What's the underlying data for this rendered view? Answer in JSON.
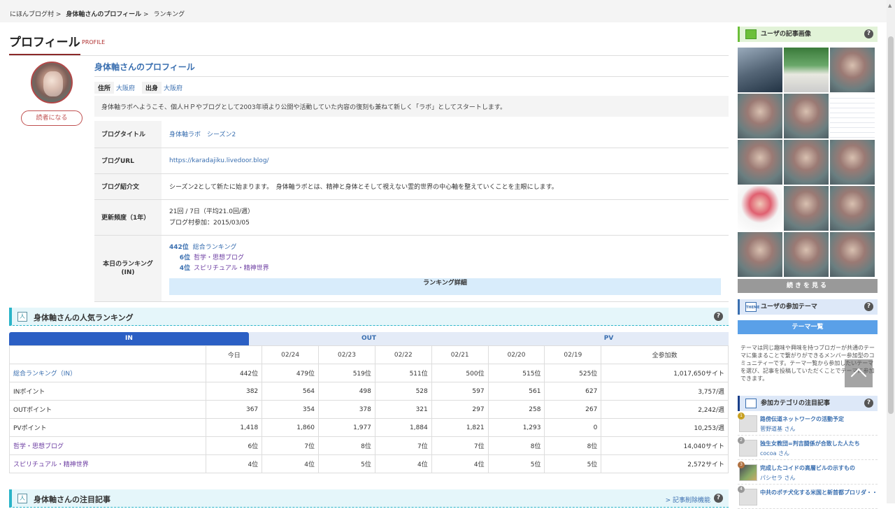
{
  "breadcrumb": [
    "にほんブログ村",
    ">",
    "身体軸さんのプロフィール",
    ">",
    "ランキング"
  ],
  "page_title": "プロフィール",
  "page_title_sub": "PROFILE",
  "profile": {
    "name": "身体軸さんのプロフィール",
    "reader_button": "読者になる",
    "location_label": "住所",
    "location_value": "大阪府",
    "origin_label": "出身",
    "origin_value": "大阪府",
    "intro": "身体軸ラボへようこそ、個人ＨＰやブログとして2003年頃より公開や活動していた内容の復刻も兼ねて新しく「ラボ」としてスタートします。"
  },
  "profile_table": {
    "blog_title_label": "ブログタイトル",
    "blog_title_value": "身体軸ラボ　シーズン2",
    "blog_url_label": "ブログURL",
    "blog_url_value": "https://karadajiku.livedoor.blog/",
    "blog_intro_label": "ブログ紹介文",
    "blog_intro_value": "シーズン2として新たに始まります。　身体軸ラボとは、精神と身体とそして視えない霊的世界の中心軸を整えていくことを主眼にします。",
    "update_label": "更新頻度（1年）",
    "update_value_1": "21回 / 7日（平均21.0回/週）",
    "update_value_2": "ブログ村参加：2015/03/05",
    "ranking_label_1": "本日のランキング",
    "ranking_label_2": "(IN)",
    "rankings": [
      {
        "pos": "442位",
        "name": "総合ランキング"
      },
      {
        "pos": "6位",
        "name": "哲学・思想ブログ"
      },
      {
        "pos": "4位",
        "name": "スピリチュアル・精神世界"
      }
    ],
    "ranking_detail_button": "ランキング詳細"
  },
  "popular_section": {
    "icon": "人",
    "title": "身体軸さんの人気ランキング",
    "help": "?"
  },
  "tabs": [
    "IN",
    "OUT",
    "PV"
  ],
  "ranking_table": {
    "headers": [
      "",
      "今日",
      "02/24",
      "02/23",
      "02/22",
      "02/21",
      "02/20",
      "02/19",
      "全参加数"
    ],
    "rows": [
      {
        "label": "総合ランキング（IN）",
        "cells": [
          "442位",
          "479位",
          "519位",
          "511位",
          "500位",
          "515位",
          "525位",
          "1,017,650サイト"
        ]
      },
      {
        "label": "INポイント",
        "cells": [
          "382",
          "564",
          "498",
          "528",
          "597",
          "561",
          "627",
          "3,757/週"
        ]
      },
      {
        "label": "OUTポイント",
        "cells": [
          "367",
          "354",
          "378",
          "321",
          "297",
          "258",
          "267",
          "2,242/週"
        ]
      },
      {
        "label": "PVポイント",
        "cells": [
          "1,418",
          "1,860",
          "1,977",
          "1,884",
          "1,821",
          "1,293",
          "0",
          "10,253/週"
        ]
      },
      {
        "label": "哲学・思想ブログ",
        "cells": [
          "6位",
          "7位",
          "8位",
          "7位",
          "7位",
          "8位",
          "8位",
          "14,040サイト"
        ]
      },
      {
        "label": "スピリチュアル・精神世界",
        "cells": [
          "4位",
          "4位",
          "5位",
          "4位",
          "4位",
          "5位",
          "5位",
          "2,572サイト"
        ]
      }
    ]
  },
  "notable_section": {
    "icon": "人",
    "title": "身体軸さんの注目記事",
    "delete_link": "> 記事削除機能",
    "help": "?"
  },
  "sidebar": {
    "images_title": "ユーザの記事画像",
    "more_button": "続きを見る",
    "theme_icon": "THEME",
    "theme_title": "ユーザの参加テーマ",
    "theme_button": "テーマ一覧",
    "theme_text": "テーマは同じ趣味や興味を持つブロガーが共通のテーマに集まることで繋がりができるメンバー参加型のコミュニティーです。テーマ一覧から参加したいテーマを選び、記事を投稿していただくことでテーマに参加できます。",
    "category_title": "参加カテゴリの注目記事",
    "help": "?",
    "category_items": [
      {
        "num": "1",
        "title": "路傍伝道ネットワークの活動予定",
        "author": "菅野道基 さん"
      },
      {
        "num": "2",
        "title": "独生女教団=判吉闘係が合致した人たち",
        "author": "cocoa さん"
      },
      {
        "num": "3",
        "title": "完成したコイドの高層ビルの示すもの",
        "author": "パシセラ さん"
      },
      {
        "num": "4",
        "title": "中共のポチ犬化する米国と新首都プロリダ・・・",
        "author": ""
      }
    ]
  }
}
